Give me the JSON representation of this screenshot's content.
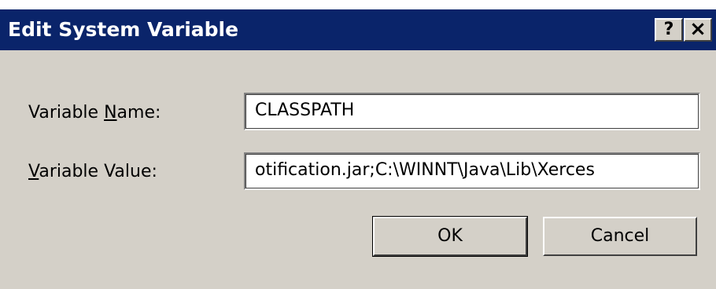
{
  "dialog": {
    "title": "Edit System Variable",
    "help_button": "?",
    "close_button": "×"
  },
  "form": {
    "name_label": "Variable Name:",
    "name_value": "CLASSPATH",
    "value_label": "Variable Value:",
    "value_value": "otification.jar;C:\\WINNT\\Java\\Lib\\Xerces"
  },
  "buttons": {
    "ok": "OK",
    "cancel": "Cancel"
  },
  "colors": {
    "titlebar": "#0a246a",
    "dialog_face": "#d4d0c8"
  }
}
